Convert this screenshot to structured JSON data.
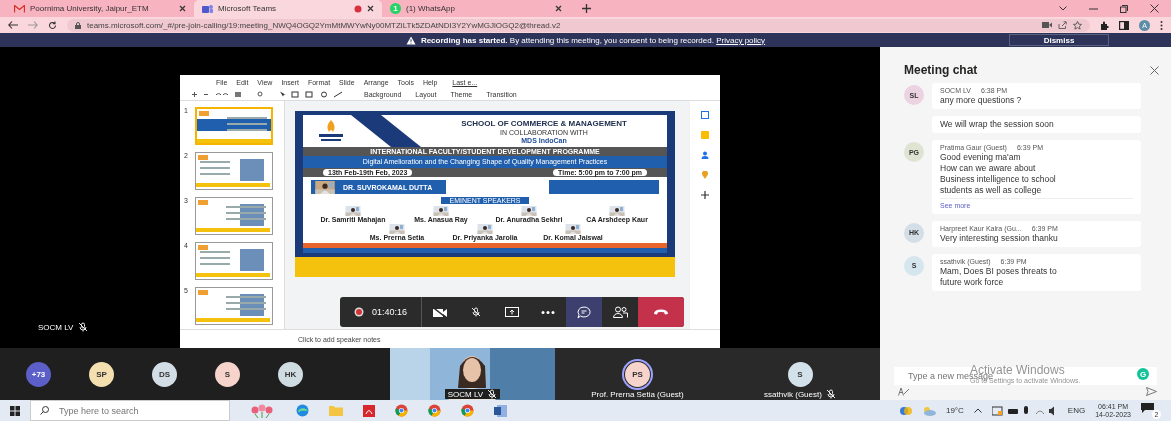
{
  "browser": {
    "tabs": [
      {
        "kind": "gmail",
        "title": "Poornima University, Jaipur_ETM",
        "selected": false,
        "recording": false
      },
      {
        "kind": "teams",
        "title": "Microsoft Teams",
        "selected": true,
        "recording": true
      },
      {
        "kind": "whatsapp",
        "title": "(1) WhatsApp",
        "selected": false,
        "recording": false,
        "badge": "1"
      }
    ],
    "address": "teams.microsoft.com/_#/pre-join-calling/19:meeting_NWQ4OGQ2YmMtMWYwNy00MTZiLTk5ZDAtNDI3Y2YwMGJlOGQ2@thread.v2",
    "profile": "A"
  },
  "banner": {
    "bold": "Recording has started.",
    "text": "By attending this meeting, you consent to being recorded.",
    "link": "Privacy policy",
    "button": "Dismiss"
  },
  "shared_screen": {
    "menu": [
      "File",
      "Edit",
      "View",
      "Insert",
      "Format",
      "Slide",
      "Arrange",
      "Tools",
      "Help"
    ],
    "last_edit": "Last e...",
    "toolbar": [
      "Background",
      "Layout",
      "Theme",
      "Transition"
    ],
    "thumbnails": [
      {
        "number": "1",
        "selected": true
      },
      {
        "number": "2",
        "selected": false
      },
      {
        "number": "3",
        "selected": false
      },
      {
        "number": "4",
        "selected": false
      },
      {
        "number": "5",
        "selected": false
      }
    ],
    "slide": {
      "school": "SCHOOL OF COMMERCE & MANAGEMENT",
      "collab": "IN COLLABORATION WITH",
      "partner": "MDS IndoCan",
      "programme": "INTERNATIONAL FACULTY/STUDENT DEVELOPMENT PROGRAMME",
      "topic": "Digital Amelioration and the Changing Shape of Quality Management Practices",
      "dates": "13th Feb-19th Feb, 2023",
      "time": "Time: 5:00 pm to 7:00 pm",
      "keynote": "DR. SUVROKAMAL DUTTA",
      "speakers_heading": "EMINENT SPEAKERS",
      "speakers": [
        {
          "name": "Dr. Samriti Mahajan"
        },
        {
          "name": "Ms. Anasua Ray"
        },
        {
          "name": "Dr. Anuradha Sekhri"
        },
        {
          "name": "CA Arshdeep Kaur"
        },
        {
          "name": "Ms. Prerna Setia"
        },
        {
          "name": "Dr. Priyanka Jarolia"
        },
        {
          "name": "Dr. Komal Jaiswal"
        }
      ]
    },
    "notes_placeholder": "Click to add speaker notes"
  },
  "presenter": {
    "name": "SOCM LV",
    "muted": true
  },
  "call_controls": {
    "timer": "01:40:16",
    "chat_selected": true
  },
  "participants": [
    {
      "initials": "+73",
      "color": "#5b5fc7"
    },
    {
      "initials": "SP",
      "color": "#f3dfb0"
    },
    {
      "initials": "DS",
      "color": "#d3dde6"
    },
    {
      "initials": "S",
      "color": "#f6d3cb"
    },
    {
      "initials": "HK",
      "color": "#cfdce2"
    }
  ],
  "tiles": [
    {
      "kind": "video",
      "name": "SOCM LV",
      "muted": true
    },
    {
      "kind": "avatar",
      "initials": "PS",
      "name": "Prof. Prerna Setia (Guest)",
      "muted": false,
      "color": "#f6d3cb"
    },
    {
      "kind": "avatar",
      "initials": "S",
      "name": "ssathvik (Guest)",
      "muted": true,
      "color": "#d3e2ea"
    }
  ],
  "chat": {
    "title": "Meeting chat",
    "messages": [
      {
        "initials": "SL",
        "color": "#ecd3e2",
        "sender": "SOCM LV",
        "time": "6:38 PM",
        "text": "any more questions ?"
      },
      {
        "text": "We will wrap the session soon"
      },
      {
        "initials": "PG",
        "color": "#dfe4d2",
        "sender": "Pratima Gaur (Guest)",
        "time": "6:39 PM",
        "text": "Good evening ma'am\nHow can we aware about\nBusiness intelligence to school\nstudents as well as college",
        "more": "See more"
      },
      {
        "initials": "HK",
        "color": "#d3dee6",
        "sender": "Harpreet Kaur Kalra (Gu...",
        "time": "6:39 PM",
        "text": "Very interesting session thanku"
      },
      {
        "initials": "S",
        "color": "#d6e6ef",
        "sender": "ssathvik (Guest)",
        "time": "6:39 PM",
        "text": "Mam, Does BI poses threats to\nfuture work force"
      }
    ],
    "placeholder": "Type a new message",
    "grammar": "G"
  },
  "activation": {
    "title": "Activate Windows",
    "hint": "Go to Settings to activate Windows."
  },
  "taskbar": {
    "search": {
      "placeholder": "Type here to search"
    },
    "temperature": "19°C",
    "language": "ENG",
    "time": "06:41 PM",
    "date": "14-02-2023",
    "notifications": "2"
  }
}
